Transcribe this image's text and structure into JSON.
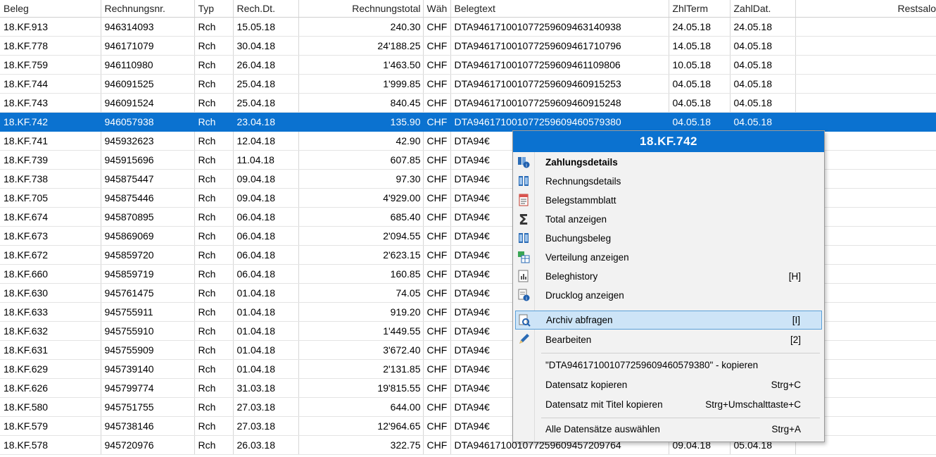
{
  "columns": [
    "Beleg",
    "Rechnungsnr.",
    "Typ",
    "Rech.Dt.",
    "Rechnungstotal",
    "Wäh",
    "Belegtext",
    "ZhlTerm",
    "ZahlDat.",
    "Restsalo"
  ],
  "rows": [
    [
      "18.KF.913",
      "946314093",
      "Rch",
      "15.05.18",
      "240.30",
      "CHF",
      "DTA946171001077259609463140938",
      "24.05.18",
      "24.05.18",
      ""
    ],
    [
      "18.KF.778",
      "946171079",
      "Rch",
      "30.04.18",
      "24'188.25",
      "CHF",
      "DTA946171001077259609461710796",
      "14.05.18",
      "04.05.18",
      ""
    ],
    [
      "18.KF.759",
      "946110980",
      "Rch",
      "26.04.18",
      "1'463.50",
      "CHF",
      "DTA946171001077259609461109806",
      "10.05.18",
      "04.05.18",
      ""
    ],
    [
      "18.KF.744",
      "946091525",
      "Rch",
      "25.04.18",
      "1'999.85",
      "CHF",
      "DTA946171001077259609460915253",
      "04.05.18",
      "04.05.18",
      ""
    ],
    [
      "18.KF.743",
      "946091524",
      "Rch",
      "25.04.18",
      "840.45",
      "CHF",
      "DTA946171001077259609460915248",
      "04.05.18",
      "04.05.18",
      ""
    ],
    [
      "18.KF.742",
      "946057938",
      "Rch",
      "23.04.18",
      "135.90",
      "CHF",
      "DTA946171001077259609460579380",
      "04.05.18",
      "04.05.18",
      ""
    ],
    [
      "18.KF.741",
      "945932623",
      "Rch",
      "12.04.18",
      "42.90",
      "CHF",
      "DTA94€",
      "",
      "",
      ""
    ],
    [
      "18.KF.739",
      "945915696",
      "Rch",
      "11.04.18",
      "607.85",
      "CHF",
      "DTA94€",
      "",
      "",
      ""
    ],
    [
      "18.KF.738",
      "945875447",
      "Rch",
      "09.04.18",
      "97.30",
      "CHF",
      "DTA94€",
      "",
      "",
      ""
    ],
    [
      "18.KF.705",
      "945875446",
      "Rch",
      "09.04.18",
      "4'929.00",
      "CHF",
      "DTA94€",
      "",
      "",
      ""
    ],
    [
      "18.KF.674",
      "945870895",
      "Rch",
      "06.04.18",
      "685.40",
      "CHF",
      "DTA94€",
      "",
      "",
      ""
    ],
    [
      "18.KF.673",
      "945869069",
      "Rch",
      "06.04.18",
      "2'094.55",
      "CHF",
      "DTA94€",
      "",
      "",
      ""
    ],
    [
      "18.KF.672",
      "945859720",
      "Rch",
      "06.04.18",
      "2'623.15",
      "CHF",
      "DTA94€",
      "",
      "",
      ""
    ],
    [
      "18.KF.660",
      "945859719",
      "Rch",
      "06.04.18",
      "160.85",
      "CHF",
      "DTA94€",
      "",
      "",
      ""
    ],
    [
      "18.KF.630",
      "945761475",
      "Rch",
      "01.04.18",
      "74.05",
      "CHF",
      "DTA94€",
      "",
      "",
      ""
    ],
    [
      "18.KF.633",
      "945755911",
      "Rch",
      "01.04.18",
      "919.20",
      "CHF",
      "DTA94€",
      "",
      "",
      ""
    ],
    [
      "18.KF.632",
      "945755910",
      "Rch",
      "01.04.18",
      "1'449.55",
      "CHF",
      "DTA94€",
      "",
      "",
      ""
    ],
    [
      "18.KF.631",
      "945755909",
      "Rch",
      "01.04.18",
      "3'672.40",
      "CHF",
      "DTA94€",
      "",
      "",
      ""
    ],
    [
      "18.KF.629",
      "945739140",
      "Rch",
      "01.04.18",
      "2'131.85",
      "CHF",
      "DTA94€",
      "",
      "",
      ""
    ],
    [
      "18.KF.626",
      "945799774",
      "Rch",
      "31.03.18",
      "19'815.55",
      "CHF",
      "DTA94€",
      "",
      "",
      ""
    ],
    [
      "18.KF.580",
      "945751755",
      "Rch",
      "27.03.18",
      "644.00",
      "CHF",
      "DTA94€",
      "",
      "",
      ""
    ],
    [
      "18.KF.579",
      "945738146",
      "Rch",
      "27.03.18",
      "12'964.65",
      "CHF",
      "DTA94€",
      "",
      "",
      ""
    ],
    [
      "18.KF.578",
      "945720976",
      "Rch",
      "26.03.18",
      "322.75",
      "CHF",
      "DTA946171001077259609457209764",
      "09.04.18",
      "05.04.18",
      ""
    ]
  ],
  "selected_row": 5,
  "menu": {
    "title": "18.KF.742",
    "items": [
      {
        "label": "Zahlungsdetails",
        "shortcut": "",
        "icon": "payment-details-icon"
      },
      {
        "label": "Rechnungsdetails",
        "shortcut": "",
        "icon": "invoice-details-icon"
      },
      {
        "label": "Belegstammblatt",
        "shortcut": "",
        "icon": "document-sheet-icon"
      },
      {
        "label": "Total anzeigen",
        "shortcut": "",
        "icon": "sigma-icon"
      },
      {
        "label": "Buchungsbeleg",
        "shortcut": "",
        "icon": "booking-voucher-icon"
      },
      {
        "label": "Verteilung anzeigen",
        "shortcut": "",
        "icon": "distribution-icon"
      },
      {
        "label": "Beleghistory",
        "shortcut": "[H]",
        "icon": "history-icon"
      },
      {
        "label": "Drucklog anzeigen",
        "shortcut": "",
        "icon": "print-log-icon"
      },
      {
        "label": "Archiv abfragen",
        "shortcut": "[I]",
        "icon": "archive-query-icon"
      },
      {
        "label": "Bearbeiten",
        "shortcut": "[2]",
        "icon": "pencil-icon"
      }
    ],
    "copy_items": [
      {
        "label": "\"DTA946171001077259609460579380\" - kopieren",
        "shortcut": ""
      },
      {
        "label": "Datensatz kopieren",
        "shortcut": "Strg+C"
      },
      {
        "label": "Datensatz mit Titel kopieren",
        "shortcut": "Strg+Umschalttaste+C"
      }
    ],
    "select_all": {
      "label": "Alle Datensätze auswählen",
      "shortcut": "Strg+A"
    }
  },
  "colors": {
    "selection": "#0b72d0",
    "menu_highlight": "#cde4f7"
  }
}
